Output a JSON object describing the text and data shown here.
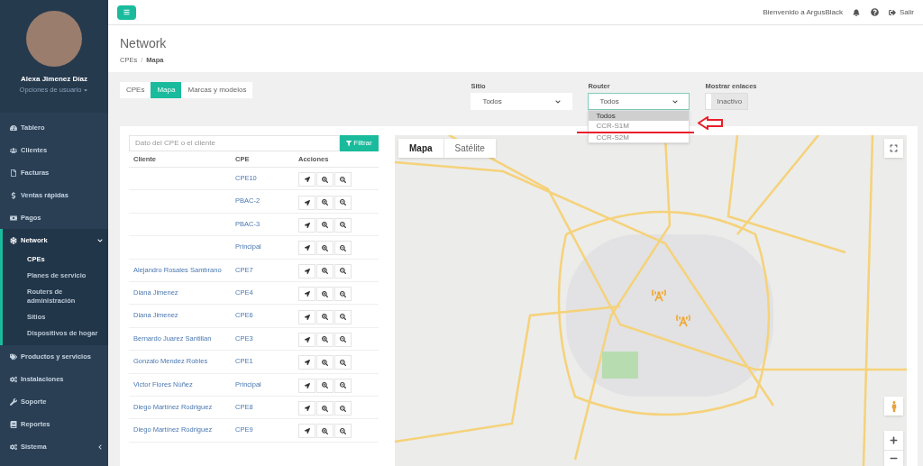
{
  "sidebar": {
    "user": {
      "name": "Alexa Jimenez Díaz",
      "options": "Opciones de usuario"
    },
    "items": [
      {
        "label": "Tablero",
        "expanded": false,
        "collapsible": false
      },
      {
        "label": "Clientes",
        "expanded": false,
        "collapsible": false
      },
      {
        "label": "Facturas",
        "expanded": false,
        "collapsible": false
      },
      {
        "label": "Ventas rápidas",
        "expanded": false,
        "collapsible": false
      },
      {
        "label": "Pagos",
        "expanded": false,
        "collapsible": false
      },
      {
        "label": "Network",
        "expanded": true,
        "collapsible": true,
        "children": [
          {
            "label": "CPEs",
            "selected": true
          },
          {
            "label": "Planes de servicio",
            "selected": false
          },
          {
            "label": "Routers de administración",
            "selected": false
          },
          {
            "label": "Sitios",
            "selected": false
          },
          {
            "label": "Dispositivos de hogar",
            "selected": false
          }
        ]
      },
      {
        "label": "Productos y servicios",
        "expanded": false,
        "collapsible": false
      },
      {
        "label": "Instalaciones",
        "expanded": false,
        "collapsible": false
      },
      {
        "label": "Soporte",
        "expanded": false,
        "collapsible": false
      },
      {
        "label": "Reportes",
        "expanded": false,
        "collapsible": false
      },
      {
        "label": "Sistema",
        "expanded": false,
        "collapsible": true
      }
    ]
  },
  "topbar": {
    "welcome": "Bienvenido a ArgusBlack",
    "logout": "Salir"
  },
  "page": {
    "title": "Network",
    "breadcrumb": [
      "CPEs",
      "Mapa"
    ],
    "breadcrumb_separator": "/"
  },
  "tabs": [
    {
      "label": "CPEs",
      "selected": false
    },
    {
      "label": "Mapa",
      "selected": true
    },
    {
      "label": "Marcas y modelos",
      "selected": false
    }
  ],
  "filters": {
    "site": {
      "label": "Sitio",
      "value": "Todos"
    },
    "router": {
      "label": "Router",
      "value": "Todos",
      "expanded": true,
      "options": [
        {
          "label": "Todos",
          "selected": true
        },
        {
          "label": "CCR-S1M",
          "selected": false
        },
        {
          "label": "CCR-S2M",
          "selected": false
        }
      ]
    },
    "links": {
      "label": "Mostrar enlaces",
      "state": "Inactivo",
      "on": false
    }
  },
  "search": {
    "placeholder": "Dato del CPE o el cliente",
    "button": "Filtrar"
  },
  "table": {
    "columns": [
      "Cliente",
      "CPE",
      "Acciones"
    ],
    "rows": [
      {
        "client": "",
        "cpe": "CPE10"
      },
      {
        "client": "",
        "cpe": "PBAC-2"
      },
      {
        "client": "",
        "cpe": "PBAC-3"
      },
      {
        "client": "",
        "cpe": "Principal"
      },
      {
        "client": "Alejandro Rosales Sambrano",
        "cpe": "CPE7"
      },
      {
        "client": "Diana Jimenez",
        "cpe": "CPE4"
      },
      {
        "client": "Diana Jimenez",
        "cpe": "CPE6"
      },
      {
        "client": "Bernardo Juarez Santillan",
        "cpe": "CPE3"
      },
      {
        "client": "Gonzalo Mendez Robles",
        "cpe": "CPE1"
      },
      {
        "client": "Victor Flores Núñez",
        "cpe": "Principal"
      },
      {
        "client": "Diego Martínez Rodriguez",
        "cpe": "CPE8"
      },
      {
        "client": "Diego Martínez Rodriguez",
        "cpe": "CPE9"
      }
    ]
  },
  "map": {
    "types": [
      {
        "label": "Mapa",
        "selected": true
      },
      {
        "label": "Satélite",
        "selected": false
      }
    ]
  }
}
